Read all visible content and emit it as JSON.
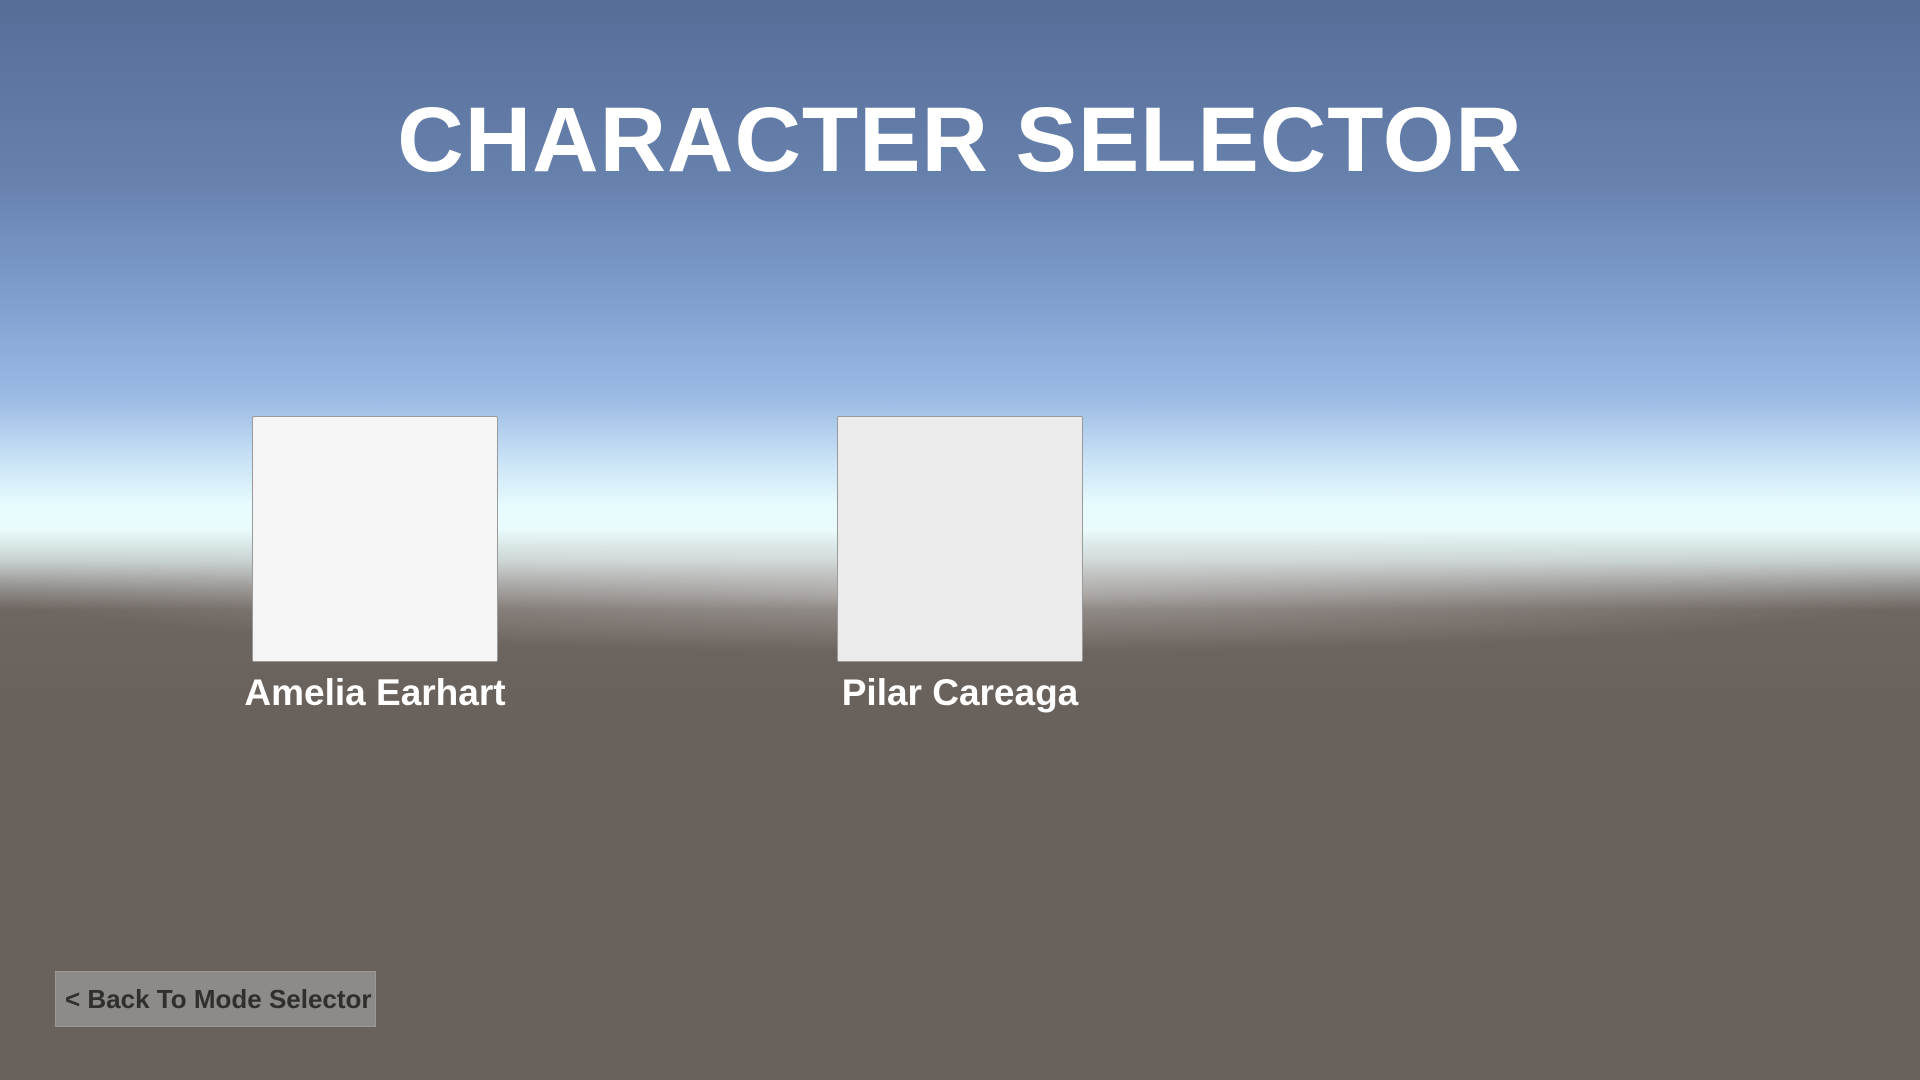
{
  "screen": {
    "title": "CHARACTER SELECTOR"
  },
  "characters": [
    {
      "name": "Amelia Earhart"
    },
    {
      "name": "Pilar Careaga"
    }
  ],
  "navigation": {
    "back_label": "< Back To Mode Selector"
  },
  "colors": {
    "sky_top": "#566d98",
    "horizon": "#e6fbfd",
    "ground": "#69615b",
    "text": "#ffffff",
    "button_bg": "#8d8a87",
    "button_text": "#2f2f2f"
  }
}
